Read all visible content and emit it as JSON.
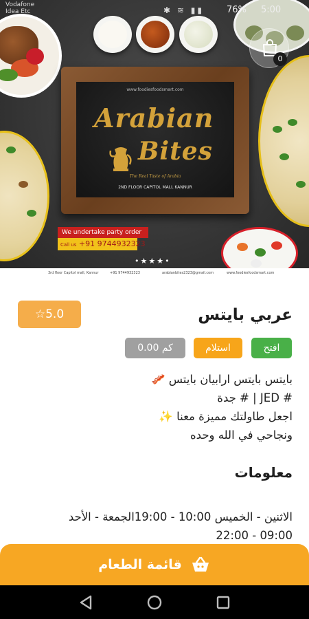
{
  "status_bar": {
    "carrier_line1": "Vodafone",
    "carrier_line2": "Idea Etc",
    "battery": "76%",
    "time": "5:00"
  },
  "hero": {
    "flyer_url": "www.foodiesfoodsmart.com",
    "logo_line1": "Arabian",
    "logo_line2": "Bites",
    "logo_tagline": "The Real Taste of Arabia",
    "logo_address": "2ND FLOOR CAPITOL MALL KANNUR",
    "party_text": "We undertake party order",
    "call_prefix": "Call us",
    "phone": "+91 9744932323",
    "footer_address": "3rd floor Capitol mall, Kannur",
    "footer_phone": "+91 9744932323",
    "footer_email": "arabianbites2323@gmail.com",
    "footer_site": "www.foodiesfoodsmart.com"
  },
  "cart": {
    "count": "0",
    "icon": "shopping-bag-icon"
  },
  "restaurant": {
    "name": "عربي بايتس",
    "rating": "5.0",
    "status_open": "افتح",
    "pickup": "استلام",
    "distance": "0.00 كم"
  },
  "description": {
    "line1": "بايتس بايتس ارابيان بايتس 🥓",
    "line2": "# JED | # جدة",
    "line3": "اجعل طاولتك مميزة معنا ✨",
    "line4": "ونجاحي في الله وحده"
  },
  "info": {
    "title": "معلومات",
    "hours_line1": "الاثنين - الخميس 10:00 - 19:00الجمعة - الأحد",
    "hours_line2": "09:00 - 22:00"
  },
  "menu_button": {
    "label": "قائمة الطعام",
    "icon": "basket-icon"
  },
  "colors": {
    "accent": "#f7a723",
    "rating_bg": "#f5ad4a",
    "open_green": "#49b048",
    "pickup_orange": "#f7a51a",
    "distance_gray": "#a0a0a0"
  }
}
